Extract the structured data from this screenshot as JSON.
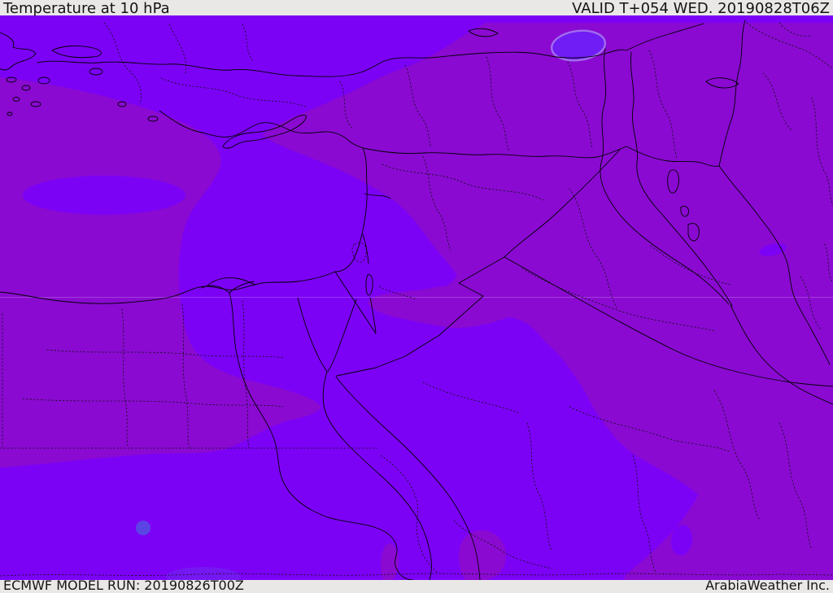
{
  "header": {
    "title": "Temperature at 10 hPa",
    "valid": "VALID T+054 WED. 20190828T06Z"
  },
  "footer": {
    "model_run": "ECMWF MODEL RUN: 20190826T00Z",
    "brand": "ArabiaWeather Inc."
  },
  "colors": {
    "c-bar-bg": "#e9e8e6",
    "c-bar-text": "#141414",
    "c-bright": "#7c02f6",
    "c-muted": "#8a0ad2",
    "c-spot-blue": "#5b44e4",
    "c-blob-blueviolet": "#6f1cf5",
    "c-blob-rim": "#a06cec",
    "c-bottom-tint": "#7517f3",
    "c-line": "#000000"
  }
}
